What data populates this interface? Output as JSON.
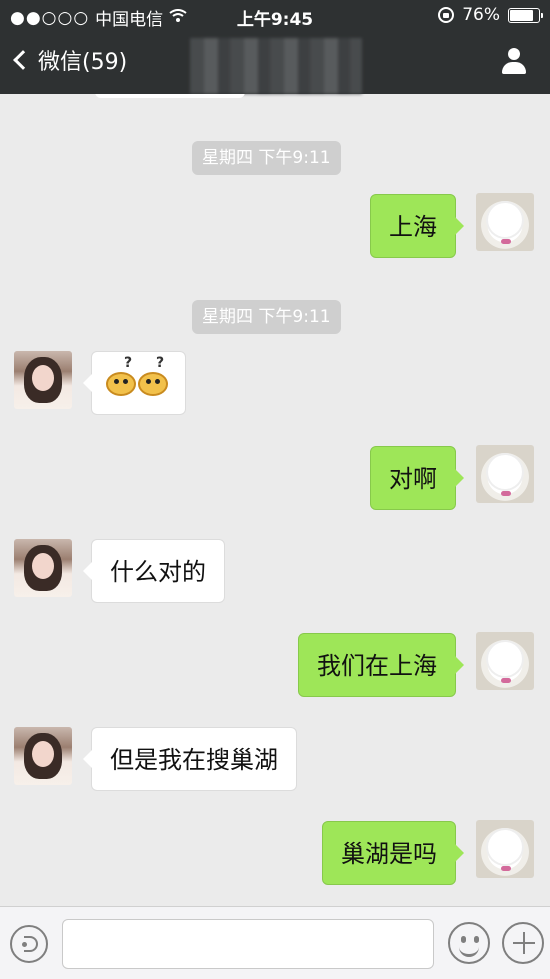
{
  "status_bar": {
    "signal_dots": "●●○○○",
    "carrier": "中国电信",
    "wifi_icon": "wifi-icon",
    "time": "上午9:45",
    "battery_percent": "76%",
    "battery_level": 0.76
  },
  "nav": {
    "back_label": "微信(59)",
    "title_obscured": true,
    "profile_icon": "person-icon"
  },
  "messages": [
    {
      "type": "time",
      "text": "星期四  下午9:11"
    },
    {
      "type": "me",
      "text": "上海"
    },
    {
      "type": "time",
      "text": "星期四  下午9:11"
    },
    {
      "type": "them",
      "text": "",
      "content": "emoji-pair"
    },
    {
      "type": "me",
      "text": "对啊"
    },
    {
      "type": "them",
      "text": "什么对的"
    },
    {
      "type": "me",
      "text": "我们在上海"
    },
    {
      "type": "them",
      "text": "但是我在搜巢湖"
    },
    {
      "type": "me",
      "text": "巢湖是吗"
    }
  ],
  "input_bar": {
    "voice_icon": "voice-icon",
    "text_value": "",
    "emoji_icon": "smile-icon",
    "more_icon": "plus-icon"
  }
}
